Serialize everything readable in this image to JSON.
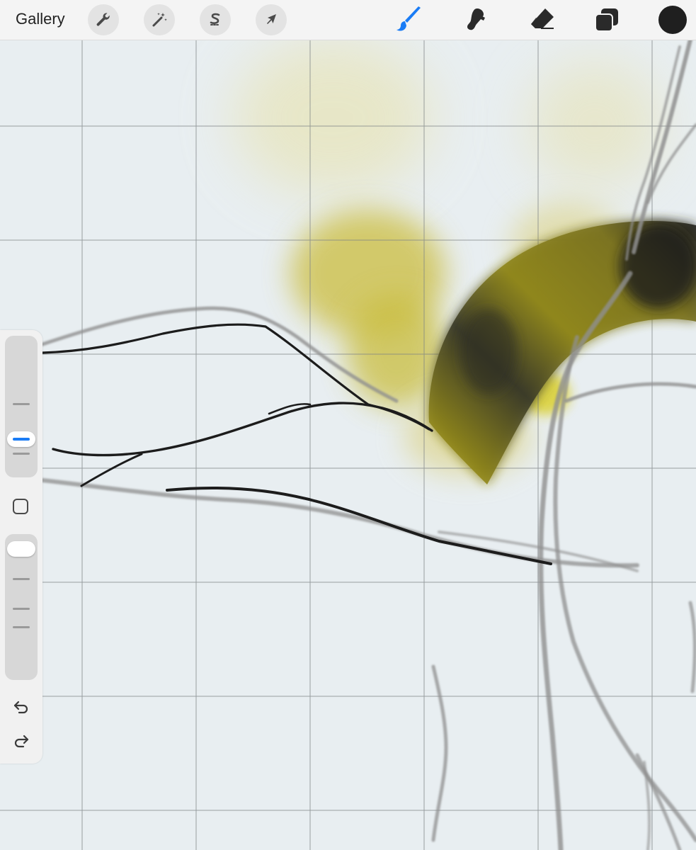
{
  "toolbar": {
    "gallery_label": "Gallery",
    "left_tools": [
      {
        "name": "actions",
        "icon": "wrench-icon"
      },
      {
        "name": "adjustments",
        "icon": "magic-wand-icon"
      },
      {
        "name": "selection",
        "icon": "selection-s-icon"
      },
      {
        "name": "transform",
        "icon": "arrow-cursor-icon"
      }
    ],
    "right_tools": [
      {
        "name": "brush",
        "icon": "brush-icon",
        "active": true
      },
      {
        "name": "smudge",
        "icon": "smudge-icon",
        "active": false
      },
      {
        "name": "eraser",
        "icon": "eraser-icon",
        "active": false
      },
      {
        "name": "layers",
        "icon": "layers-icon",
        "active": false
      }
    ],
    "current_color": "#1f1f1f"
  },
  "sidebar": {
    "brush_size_level": 0.7,
    "brush_opacity_level": 1.0,
    "modify_icon": "square-icon",
    "undo_icon": "undo-icon",
    "redo_icon": "redo-icon"
  },
  "colors": {
    "accent": "#1a7cf5",
    "canvas": "#e8eef1",
    "grid": "#7a7f82",
    "ink": "#1e1e1e",
    "sketch": "#9a9a9a",
    "yellow_paint": "#b8ab10"
  }
}
